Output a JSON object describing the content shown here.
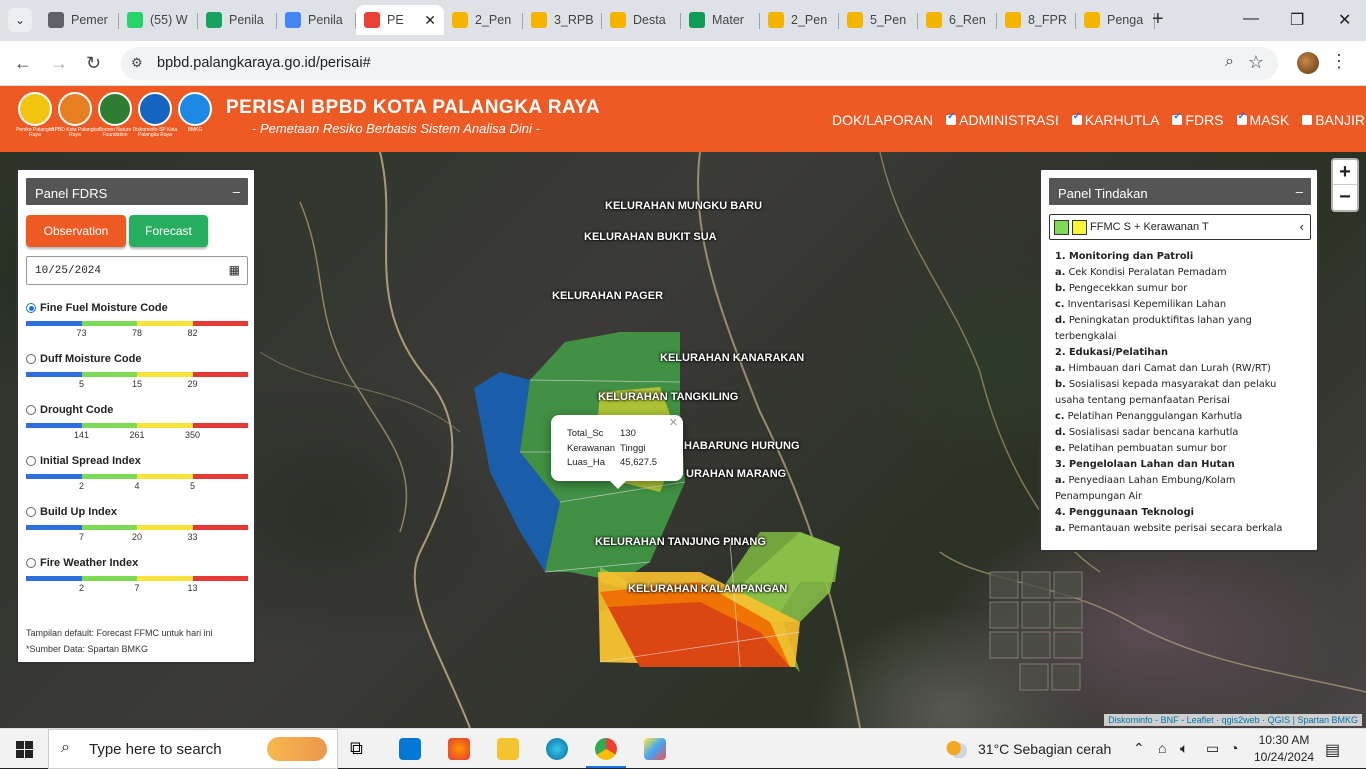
{
  "browser": {
    "tabs": [
      {
        "title": "Pemer",
        "color": "#5f6368"
      },
      {
        "title": "(55) W",
        "color": "#25d366"
      },
      {
        "title": "Penila",
        "color": "#1aa260"
      },
      {
        "title": "Penila",
        "color": "#4285f4"
      },
      {
        "title": "PE",
        "color": "#ea4335",
        "active": true
      },
      {
        "title": "2_Pen",
        "color": "#f4b400"
      },
      {
        "title": "3_RPB",
        "color": "#f4b400"
      },
      {
        "title": "Desta",
        "color": "#f4b400"
      },
      {
        "title": "Mater",
        "color": "#0f9d58"
      },
      {
        "title": "2_Pen",
        "color": "#f4b400"
      },
      {
        "title": "5_Pen",
        "color": "#f4b400"
      },
      {
        "title": "6_Ren",
        "color": "#f4b400"
      },
      {
        "title": "8_FPR",
        "color": "#f4b400"
      },
      {
        "title": "Penga",
        "color": "#f4b400"
      }
    ],
    "url": "bpbd.palangkaraya.go.id/perisai#"
  },
  "header": {
    "title": "PERISAI BPBD KOTA PALANGKA RAYA",
    "subtitle": "- Pemetaan Resiko Berbasis Sistem Analisa Dini -",
    "logos": [
      {
        "caption": "Pemko Palangka Raya",
        "color": "#f1c40f"
      },
      {
        "caption": "BPBD Kota Palangka Raya",
        "color": "#e67e22"
      },
      {
        "caption": "Borneo Nature Foundation",
        "color": "#2e7d32"
      },
      {
        "caption": "Diskominfo-SP Kota Palangka Raya",
        "color": "#1565c0"
      },
      {
        "caption": "BMKG",
        "color": "#1e88e5"
      }
    ],
    "nav": {
      "dok": "DOK/LAPORAN",
      "layers": [
        {
          "label": "ADMINISTRASI",
          "checked": true
        },
        {
          "label": "KARHUTLA",
          "checked": true
        },
        {
          "label": "FDRS",
          "checked": true
        },
        {
          "label": "MASK",
          "checked": true
        },
        {
          "label": "BANJIR",
          "checked": false
        }
      ]
    }
  },
  "fdrs_panel": {
    "title": "Panel FDRS",
    "observation_label": "Observation",
    "forecast_label": "Forecast",
    "date": "10/25/2024",
    "scale_colors": [
      "#2f6fdc",
      "#7ed957",
      "#f7e43a",
      "#e53935"
    ],
    "indices": [
      {
        "label": "Fine Fuel Moisture Code",
        "ticks": [
          "73",
          "78",
          "82"
        ],
        "selected": true
      },
      {
        "label": "Duff Moisture Code",
        "ticks": [
          "5",
          "15",
          "29"
        ],
        "selected": false
      },
      {
        "label": "Drought Code",
        "ticks": [
          "141",
          "261",
          "350"
        ],
        "selected": false
      },
      {
        "label": "Initial Spread Index",
        "ticks": [
          "2",
          "4",
          "5"
        ],
        "selected": false
      },
      {
        "label": "Build Up Index",
        "ticks": [
          "7",
          "20",
          "33"
        ],
        "selected": false
      },
      {
        "label": "Fire Weather Index",
        "ticks": [
          "2",
          "7",
          "13"
        ],
        "selected": false
      }
    ],
    "note1": "Tampilan default: Forecast FFMC untuk hari ini",
    "note2": "*Sumber Data: Spartan BMKG"
  },
  "tindakan_panel": {
    "title": "Panel Tindakan",
    "select_value": "FFMC S + Kerawanan T",
    "swatch_colors": [
      "#7ed957",
      "#f7f73a"
    ],
    "lines": [
      {
        "type": "sec",
        "text": "1. Monitoring dan Patroli"
      },
      {
        "type": "item",
        "letter": "a.",
        "text": "Cek Kondisi Peralatan Pemadam"
      },
      {
        "type": "item",
        "letter": "b.",
        "text": "Pengecekkan sumur bor"
      },
      {
        "type": "item",
        "letter": "c.",
        "text": "Inventarisasi Kepemilikan Lahan"
      },
      {
        "type": "item",
        "letter": "d.",
        "text": "Peningkatan produktifitas lahan yang terbengkalai"
      },
      {
        "type": "sec",
        "text": "2. Edukasi/Pelatihan"
      },
      {
        "type": "item",
        "letter": "a.",
        "text": "Himbauan dari Camat dan Lurah (RW/RT)"
      },
      {
        "type": "item",
        "letter": "b.",
        "text": "Sosialisasi kepada masyarakat dan pelaku usaha tentang pemanfaatan Perisai"
      },
      {
        "type": "item",
        "letter": "c.",
        "text": "Pelatihan Penanggulangan Karhutla"
      },
      {
        "type": "item",
        "letter": "d.",
        "text": "Sosialisasi sadar bencana karhutla"
      },
      {
        "type": "item",
        "letter": "e.",
        "text": "Pelatihan pembuatan sumur bor"
      },
      {
        "type": "sec",
        "text": "3. Pengelolaan Lahan dan Hutan"
      },
      {
        "type": "item",
        "letter": "a.",
        "text": "Penyediaan Lahan Embung/Kolam Penampungan Air"
      },
      {
        "type": "sec",
        "text": "4. Penggunaan Teknologi"
      },
      {
        "type": "item",
        "letter": "a.",
        "text": "Pemantauan website perisai secara berkala"
      }
    ]
  },
  "map": {
    "kelurahan": [
      "KELURAHAN MUNGKU BARU",
      "KELURAHAN BUKIT SUA",
      "KELURAHAN PAGER",
      "KELURAHAN KANARAKAN",
      "KELURAHAN TANGKILING",
      "HABARUNG HURUNG",
      "URAHAN MARANG",
      "KELURAHAN TANJUNG PINANG",
      "KELURAHAN KALAMPANGAN"
    ],
    "popup": {
      "rows": [
        {
          "k": "Total_Sc",
          "v": "130"
        },
        {
          "k": "Kerawanan",
          "v": "Tinggi"
        },
        {
          "k": "Luas_Ha",
          "v": "45,627.5"
        }
      ]
    },
    "zoom_in": "+",
    "zoom_out": "−",
    "attribution": "Diskominfo - BNF - Leaflet · qgis2web · QGIS | Spartan BMKG"
  },
  "taskbar": {
    "search_placeholder": "Type here to search",
    "weather": "31°C  Sebagian cerah",
    "time": "10:30 AM",
    "date": "10/24/2024"
  }
}
